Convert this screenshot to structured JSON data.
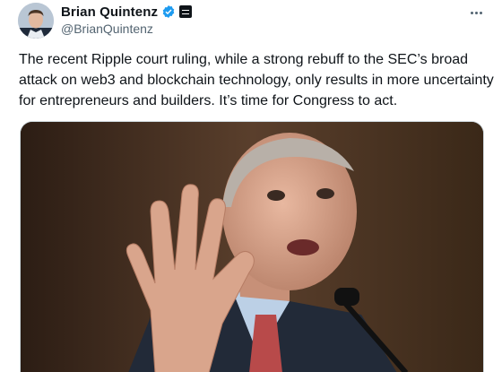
{
  "author": {
    "display_name": "Brian Quintenz",
    "handle": "@BrianQuintenz",
    "verified_icon": "verified-badge-icon",
    "affiliation_icon": "affiliation-badge-icon"
  },
  "menu": {
    "icon": "more-horizontal-icon"
  },
  "tweet": {
    "text": "The recent Ripple court ruling, while a strong rebuff to the SEC’s broad attack on web3 and blockchain technology, only results in more uncertainty for entrepreneurs and builders. It’s time for Congress to act."
  },
  "colors": {
    "text_primary": "#0f1419",
    "text_secondary": "#536471",
    "verified_blue": "#1d9bf0",
    "border": "#cfd9de"
  }
}
